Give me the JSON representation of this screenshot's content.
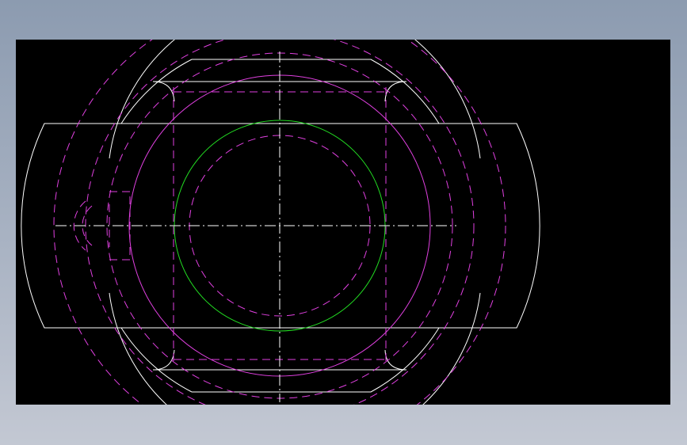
{
  "window": {
    "background": "#a9b3c3"
  },
  "viewport": {
    "background": "#000000"
  },
  "colors": {
    "outline": "#ffffff",
    "hidden": "#e040e0",
    "centerline": "#ffffff",
    "bore": "#22dd22"
  },
  "icons": []
}
